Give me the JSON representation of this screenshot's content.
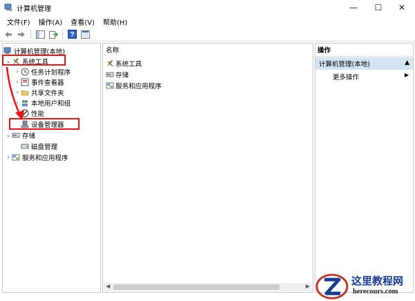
{
  "window": {
    "title": "计算机管理",
    "icon": "computer-management-icon"
  },
  "menu": [
    "文件(F)",
    "操作(A)",
    "查看(V)",
    "帮助(H)"
  ],
  "toolbar": {
    "icons": [
      "back-arrow-icon",
      "forward-arrow-icon",
      "show-hide-tree-icon",
      "export-list-icon",
      "help-icon",
      "properties-icon"
    ]
  },
  "tree": {
    "root": "计算机管理(本地)",
    "system_tools": "系统工具",
    "task_scheduler": "任务计划程序",
    "event_viewer": "事件查看器",
    "shared_folders": "共享文件夹",
    "local_users": "本地用户和组",
    "performance": "性能",
    "device_manager": "设备管理器",
    "storage": "存储",
    "disk_management": "磁盘管理",
    "services": "服务和应用程序"
  },
  "center": {
    "column_header": "名称",
    "items": [
      "系统工具",
      "存储",
      "服务和应用程序"
    ]
  },
  "actions": {
    "header": "操作",
    "section": "计算机管理(本地)",
    "item": "更多操作"
  },
  "watermark": {
    "brand": "这里教程网",
    "url": "herecours.com"
  },
  "colors": {
    "highlight_red": "#e11111",
    "actions_section_bg": "#d5e4f2",
    "watermark_blue": "#1a3d8f"
  }
}
